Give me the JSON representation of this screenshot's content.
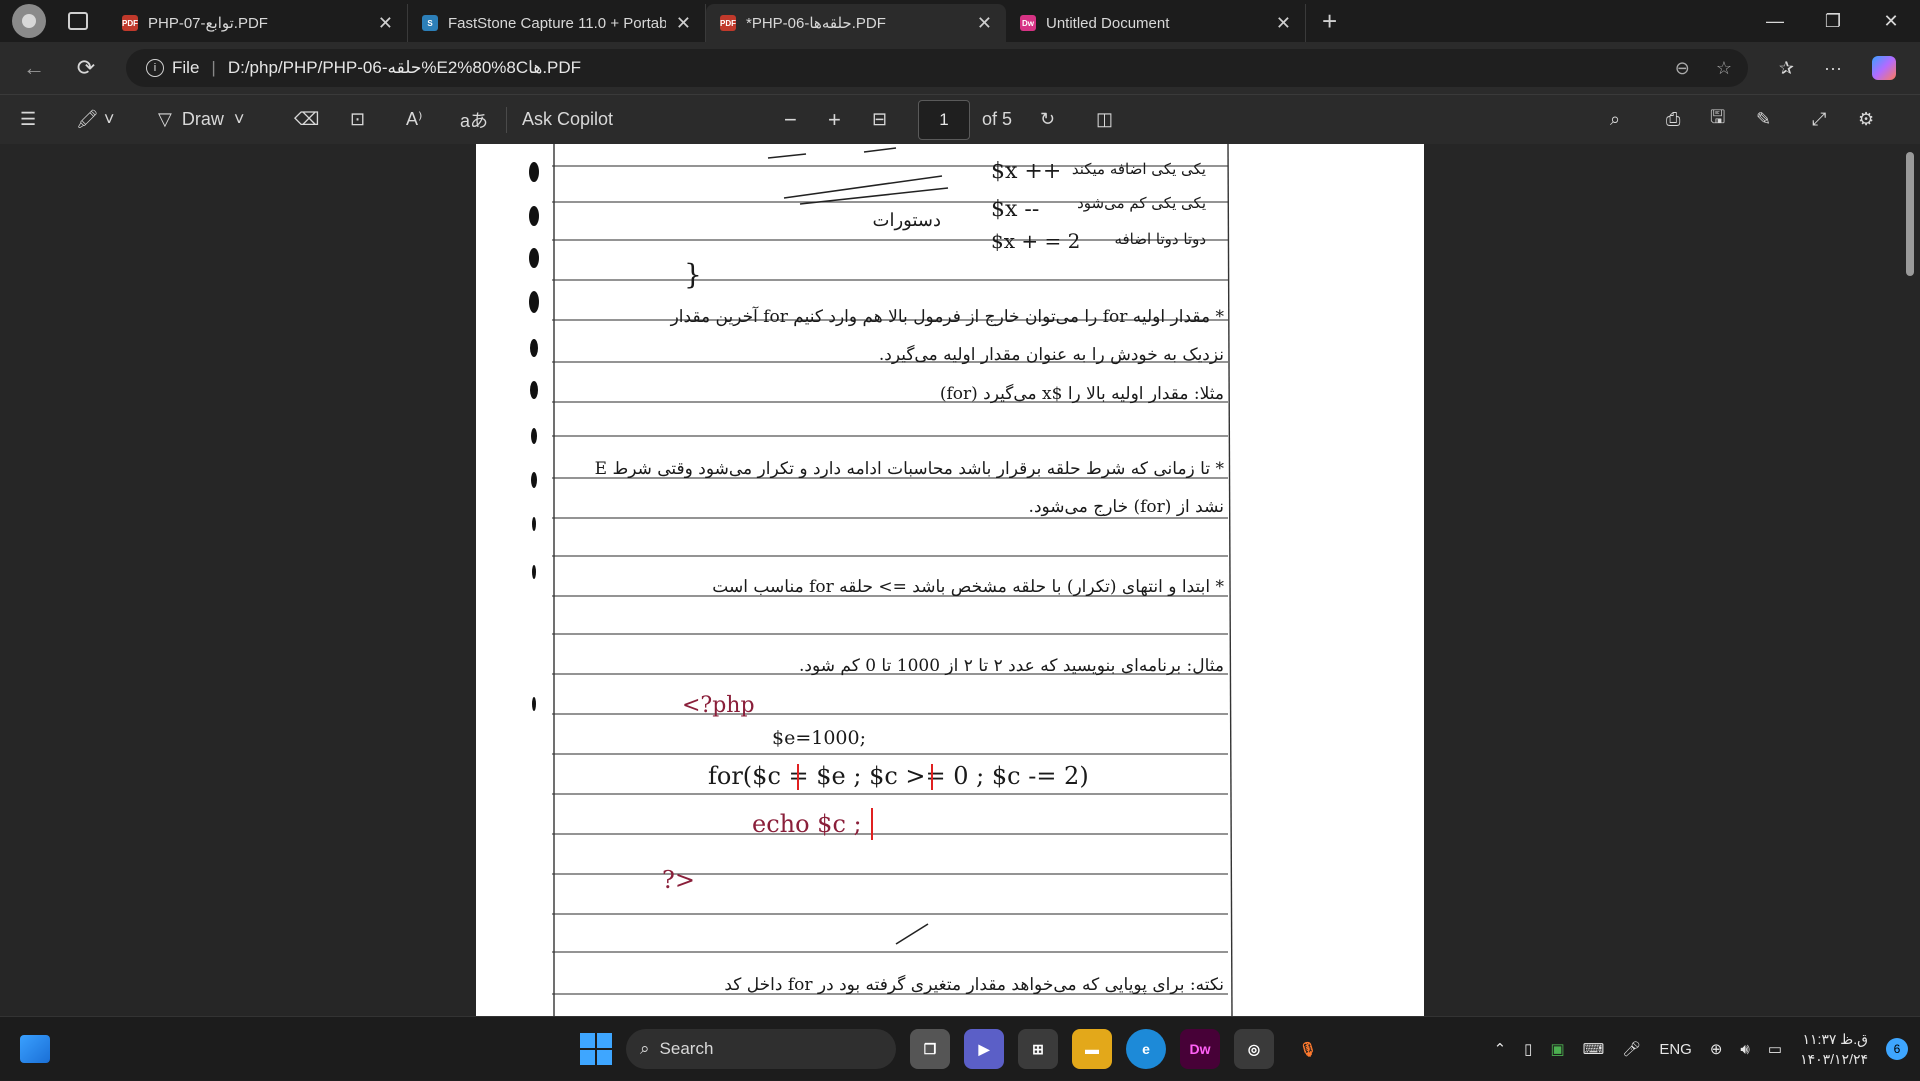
{
  "tabs": [
    {
      "title": "PHP-07-توابع.PDF",
      "icon": "pdf-icon",
      "active": false
    },
    {
      "title": "FastStone Capture 11.0 + Portable",
      "icon": "faststone-icon",
      "active": false
    },
    {
      "title": "*PHP-06-حلقه‌ها.PDF",
      "icon": "pdf-icon",
      "active": true
    },
    {
      "title": "Untitled Document",
      "icon": "dreamweaver-icon",
      "active": false
    }
  ],
  "address": {
    "scheme_label": "File",
    "url": "D:/php/PHP/PHP-06-حلقه%E2%80%8Cها.PDF"
  },
  "pdf_toolbar": {
    "draw_label": "Draw",
    "ask_copilot_label": "Ask Copilot",
    "page_number": "1",
    "page_total": "of 5"
  },
  "taskbar": {
    "search_label": "Search",
    "language": "ENG",
    "time": "۱۱:۳۷ ق.ظ",
    "date": "۱۴۰۳/۱۲/۲۴",
    "notification_count": "6"
  },
  "notes": {
    "lines": [
      {
        "text": "$x ++",
        "dir": "ltr"
      },
      {
        "text": "یکی یکی اضافه میکند",
        "dir": "rtl"
      },
      {
        "text": "دستورات",
        "dir": "rtl"
      },
      {
        "text": "$x --",
        "dir": "ltr"
      },
      {
        "text": "یکی یکی کم می‌شود",
        "dir": "rtl"
      },
      {
        "text": "$x + = 2",
        "dir": "ltr"
      },
      {
        "text": "دوتا دوتا اضافه",
        "dir": "rtl"
      },
      {
        "text": "}",
        "dir": "ltr"
      },
      {
        "text": "* مقدار اولیه for را می‌توان خارج از فرمول بالا هم وارد کنیم for آخرین مقدار",
        "dir": "rtl"
      },
      {
        "text": "نزدیک به خودش را به عنوان مقدار اولیه می‌گیرد.",
        "dir": "rtl"
      },
      {
        "text": "مثلا: مقدار اولیه بالا را $x می‌گیرد (for)",
        "dir": "rtl"
      },
      {
        "text": "* تا زمانی که شرط حلقه برقرار باشد محاسبات ادامه دارد و تکرار می‌شود وقتی شرط E",
        "dir": "rtl"
      },
      {
        "text": "نشد از (for) خارج می‌شود.",
        "dir": "rtl"
      },
      {
        "text": "* ابتدا و انتهای (تکرار) با حلقه مشخص باشد => حلقه for مناسب است",
        "dir": "rtl"
      },
      {
        "text": "مثال: برنامه‌ای بنویسید که عدد ۲ تا ۲ از 1000 تا 0 کم شود.",
        "dir": "rtl"
      },
      {
        "text": "<?php",
        "dir": "ltr"
      },
      {
        "text": "$e=1000;",
        "dir": "ltr"
      },
      {
        "text": "for($c = $e ; $c >= 0 ; $c -= 2)",
        "dir": "ltr"
      },
      {
        "text": "echo $c ;",
        "dir": "ltr"
      },
      {
        "text": "?>",
        "dir": "ltr"
      },
      {
        "text": "نکته: برای پویایی که می‌خواهد مقدار متغیری گرفته بود در for داخل کد",
        "dir": "rtl"
      }
    ]
  }
}
